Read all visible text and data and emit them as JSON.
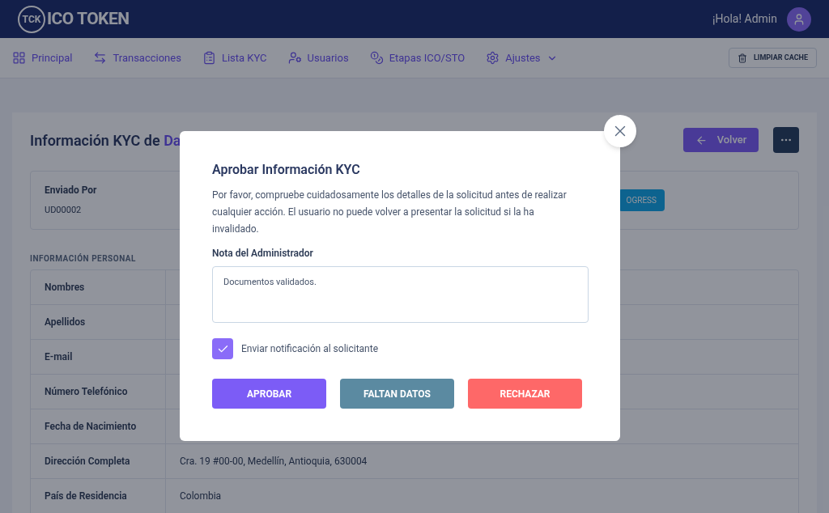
{
  "header": {
    "logo_mark": "TCK",
    "logo_text": "ICO TOKEN",
    "greeting": "¡Hola! Admin"
  },
  "nav": {
    "items": [
      {
        "label": "Principal",
        "dropdown": false
      },
      {
        "label": "Transacciones",
        "dropdown": false
      },
      {
        "label": "Lista KYC",
        "dropdown": false
      },
      {
        "label": "Usuarios",
        "dropdown": false
      },
      {
        "label": "Etapas ICO/STO",
        "dropdown": false
      },
      {
        "label": "Ajustes",
        "dropdown": true
      }
    ],
    "cache_button": "LIMPIAR CACHE"
  },
  "page": {
    "title": "Información KYC de ",
    "title_highlight": "Da",
    "back_button": "Volver",
    "submitted_by_label": "Enviado Por",
    "submitted_by": "UD00002",
    "status_badge": "OGRESS",
    "section_title": "INFORMACIÓN PERSONAL",
    "rows": [
      {
        "label": "Nombres"
      },
      {
        "label": "Apellidos"
      },
      {
        "label": "E-mail"
      },
      {
        "label": "Número Telefónico"
      },
      {
        "label": "Fecha de Nacimiento"
      },
      {
        "label": "Dirección Completa",
        "value": "Cra. 19 #00-00, Medellín, Antioquia, 630004"
      },
      {
        "label": "País de Residencia",
        "value": "Colombia"
      }
    ]
  },
  "modal": {
    "title": "Aprobar Información KYC",
    "text": "Por favor, compruebe cuidadosamente los detalles de la solicitud antes de realizar cualquier acción. El usuario no puede volver a presentar la solicitud si la ha invalidado.",
    "note_label": "Nota del Administrador",
    "note_value": "Documentos validados.",
    "notify": {
      "label": "Enviar notificación al solicitante",
      "checked": true
    },
    "buttons": [
      {
        "label": "APROBAR",
        "kind": "approve"
      },
      {
        "label": "FALTAN DATOS",
        "kind": "missing"
      },
      {
        "label": "RECHAZAR",
        "kind": "reject"
      }
    ]
  }
}
